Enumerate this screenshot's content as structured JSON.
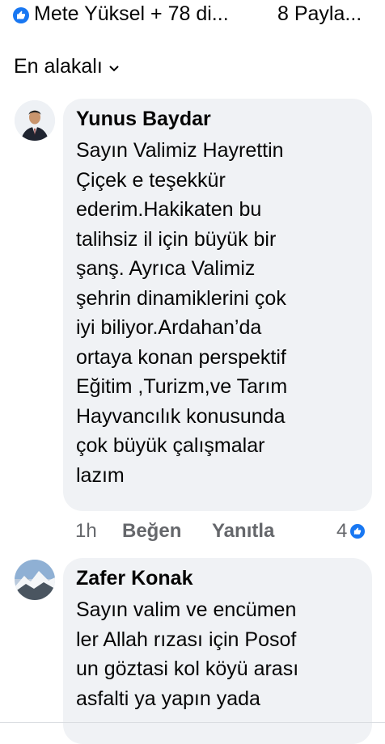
{
  "top_bar": {
    "reactors_text": "Mete Yüksel + 78 di...",
    "shares_text": "8 Payla..."
  },
  "sort": {
    "label": "En alakalı"
  },
  "comments": [
    {
      "author": "Yunus Baydar",
      "text": "Sayın Valimiz Hayrettin\nÇiçek e teşekkür\nederim.Hakikaten bu\ntalihsiz il için büyük bir\nşanş. Ayrıca Valimiz\nşehrin  dinamiklerini çok\niyi biliyor.Ardahan’da\nortaya konan  perspektif\nEğitim ,Turizm,ve Tarım\nHayvancılık konusunda\nçok büyük çalışmalar\nlazım",
      "time": "1h",
      "like_label": "Beğen",
      "reply_label": "Yanıtla",
      "reaction_count": "4"
    },
    {
      "author": "Zafer Konak",
      "text": "Sayın valim ve encümen\nler Allah rızası için Posof\nun göztasi  kol köyü arası\nasfalti ya yapın yada"
    }
  ],
  "colors": {
    "like_blue": "#1877f2",
    "bubble_bg": "#f0f2f5",
    "meta_gray": "#65676b"
  }
}
